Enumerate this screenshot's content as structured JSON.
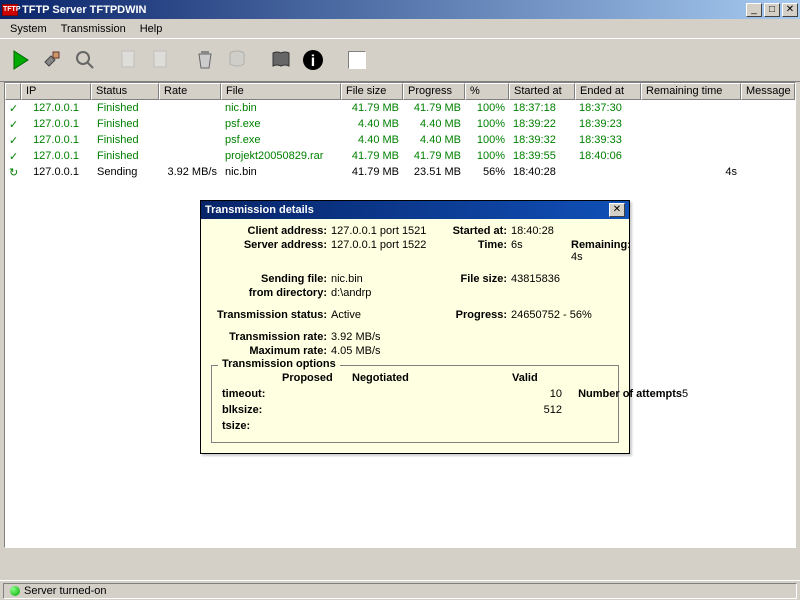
{
  "window": {
    "title": "TFTP Server TFTPDWIN"
  },
  "menu": {
    "system": "System",
    "transmission": "Transmission",
    "help": "Help"
  },
  "columns": {
    "ip": "IP",
    "status": "Status",
    "rate": "Rate",
    "file": "File",
    "filesize": "File size",
    "progress": "Progress",
    "percent": "%",
    "started": "Started at",
    "ended": "Ended at",
    "remaining": "Remaining time",
    "message": "Message"
  },
  "rows": [
    {
      "icon": "✓",
      "ip": "127.0.0.1",
      "status": "Finished",
      "rate": "",
      "file": "nic.bin",
      "filesize": "41.79 MB",
      "progress": "41.79 MB",
      "percent": "100%",
      "started": "18:37:18",
      "ended": "18:37:30",
      "remaining": "",
      "msg": "",
      "cls": "finished"
    },
    {
      "icon": "✓",
      "ip": "127.0.0.1",
      "status": "Finished",
      "rate": "",
      "file": "psf.exe",
      "filesize": "4.40 MB",
      "progress": "4.40 MB",
      "percent": "100%",
      "started": "18:39:22",
      "ended": "18:39:23",
      "remaining": "",
      "msg": "",
      "cls": "finished"
    },
    {
      "icon": "✓",
      "ip": "127.0.0.1",
      "status": "Finished",
      "rate": "",
      "file": "psf.exe",
      "filesize": "4.40 MB",
      "progress": "4.40 MB",
      "percent": "100%",
      "started": "18:39:32",
      "ended": "18:39:33",
      "remaining": "",
      "msg": "",
      "cls": "finished"
    },
    {
      "icon": "✓",
      "ip": "127.0.0.1",
      "status": "Finished",
      "rate": "",
      "file": "projekt20050829.rar",
      "filesize": "41.79 MB",
      "progress": "41.79 MB",
      "percent": "100%",
      "started": "18:39:55",
      "ended": "18:40:06",
      "remaining": "",
      "msg": "",
      "cls": "finished"
    },
    {
      "icon": "↻",
      "ip": "127.0.0.1",
      "status": "Sending",
      "rate": "3.92 MB/s",
      "file": "nic.bin",
      "filesize": "41.79 MB",
      "progress": "23.51 MB",
      "percent": "56%",
      "started": "18:40:28",
      "ended": "",
      "remaining": "4s",
      "msg": "",
      "cls": ""
    }
  ],
  "details": {
    "title": "Transmission details",
    "labels": {
      "client": "Client address:",
      "server": "Server address:",
      "sending": "Sending file:",
      "fromdir": "from directory:",
      "tstatus": "Transmission status:",
      "trate": "Transmission rate:",
      "mrate": "Maximum rate:",
      "started": "Started at:",
      "time": "Time:",
      "remaining": "Remaining:",
      "filesize": "File size:",
      "progress": "Progress:",
      "options": "Transmission options",
      "proposed": "Proposed",
      "negotiated": "Negotiated",
      "valid": "Valid",
      "timeout": "timeout:",
      "blksize": "blksize:",
      "tsize": "tsize:",
      "attempts": "Number of attempts"
    },
    "vals": {
      "client": "127.0.0.1 port 1521",
      "server": "127.0.0.1 port 1522",
      "sending": "nic.bin",
      "fromdir": "d:\\andrp",
      "tstatus": "Active",
      "trate": "3.92 MB/s",
      "mrate": "4.05 MB/s",
      "started": "18:40:28",
      "time": "6s",
      "remaining": "4s",
      "filesize": "43815836",
      "progress": "24650752 - 56%",
      "timeout_valid": "10",
      "blksize_valid": "512",
      "attempts": "5"
    }
  },
  "status": {
    "text": "Server turned-on"
  }
}
